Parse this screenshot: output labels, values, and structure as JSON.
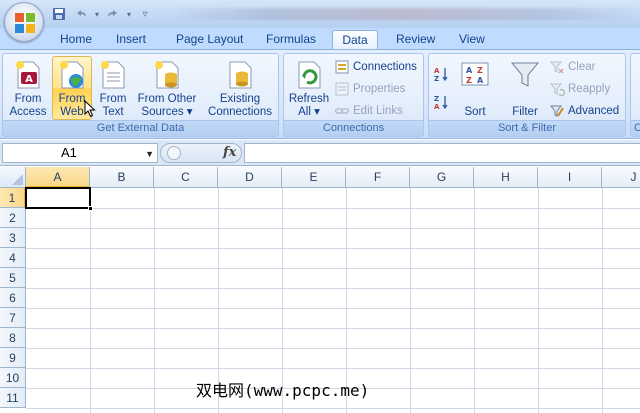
{
  "title_bar": {
    "quick_access": [
      "save-icon",
      "undo-icon",
      "redo-icon",
      "customize-icon"
    ],
    "office_button_icon": "office-logo-icon"
  },
  "tabs": [
    {
      "label": "Home",
      "active": false
    },
    {
      "label": "Insert",
      "active": false
    },
    {
      "label": "Page Layout",
      "active": false
    },
    {
      "label": "Formulas",
      "active": false
    },
    {
      "label": "Data",
      "active": true
    },
    {
      "label": "Review",
      "active": false
    },
    {
      "label": "View",
      "active": false
    }
  ],
  "ribbon": {
    "get_external_data": {
      "label": "Get External Data",
      "buttons": [
        {
          "line1": "From",
          "line2": "Access",
          "icon": "access-db-icon"
        },
        {
          "line1": "From",
          "line2": "Web",
          "icon": "web-page-icon",
          "hover": true
        },
        {
          "line1": "From",
          "line2": "Text",
          "icon": "text-file-icon"
        },
        {
          "line1": "From Other",
          "line2": "Sources ▾",
          "icon": "other-sources-icon"
        },
        {
          "line1": "Existing",
          "line2": "Connections",
          "icon": "existing-connections-icon"
        }
      ]
    },
    "connections": {
      "label": "Connections",
      "refresh_line1": "Refresh",
      "refresh_line2": "All ▾",
      "connections": "Connections",
      "properties": "Properties",
      "edit_links": "Edit Links"
    },
    "sort_filter": {
      "label": "Sort & Filter",
      "sort": "Sort",
      "filter": "Filter",
      "clear": "Clear",
      "reapply": "Reapply",
      "advanced": "Advanced"
    }
  },
  "formula_bar": {
    "name_box": "A1",
    "fx_label": "fx",
    "formula": ""
  },
  "sheet": {
    "columns": [
      "A",
      "B",
      "C",
      "D",
      "E",
      "F",
      "G",
      "H",
      "I",
      "J"
    ],
    "rows": [
      "1",
      "2",
      "3",
      "4",
      "5",
      "6",
      "7",
      "8",
      "9",
      "10",
      "11"
    ],
    "selected_cell": "A1"
  },
  "watermark": "双电网(www.pcpc.me)",
  "colors": {
    "ribbon_bg": "#dae7f8",
    "tab_text": "#15428b",
    "selection_header": "#f8d78a",
    "hover_button": "#ffe38a"
  }
}
